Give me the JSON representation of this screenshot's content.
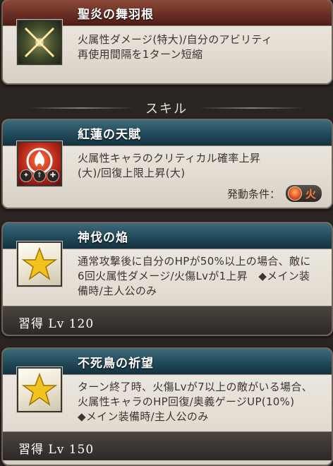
{
  "cards": {
    "c1": {
      "title": "聖炎の舞羽根",
      "line1": "火属性ダメージ(特大)/自分のアビリティ",
      "line2": "再使用間隔を1ターン短縮",
      "icon": "crossed-swords-icon"
    },
    "section": {
      "label": "スキル"
    },
    "c2": {
      "title": "紅蓮の天賦",
      "line1": "火属性キャラのクリティカル確率上昇",
      "line2": "(大)/回復上限上昇(大)",
      "cond_label": "発動条件：",
      "cond_value": "火",
      "icon": "flame-icon"
    },
    "c3": {
      "title": "神伐の焔",
      "line1": "通常攻撃後に自分のHPが50%以上の場合、敵に",
      "line2": "6回火属性ダメージ/火傷Lvが1上昇　◆メイン装",
      "line3": "備時/主人公のみ",
      "footer": "習得 Lv 120",
      "icon": "star-icon"
    },
    "c4": {
      "title": "不死鳥の祈望",
      "line1": "ターン終了時、火傷Lvが7以上の敵がいる場合、",
      "line2": "火属性キャラのHP回復/奥義ゲージUP(10%)",
      "line3": "◆メイン装備時/主人公のみ",
      "footer": "習得 Lv 150",
      "icon": "star-icon"
    }
  },
  "colors": {
    "red_header": "#6a2f24",
    "teal_header": "#224a5a",
    "card_bg": "#e3ddd3",
    "fire_text": "#ff7a3a"
  }
}
